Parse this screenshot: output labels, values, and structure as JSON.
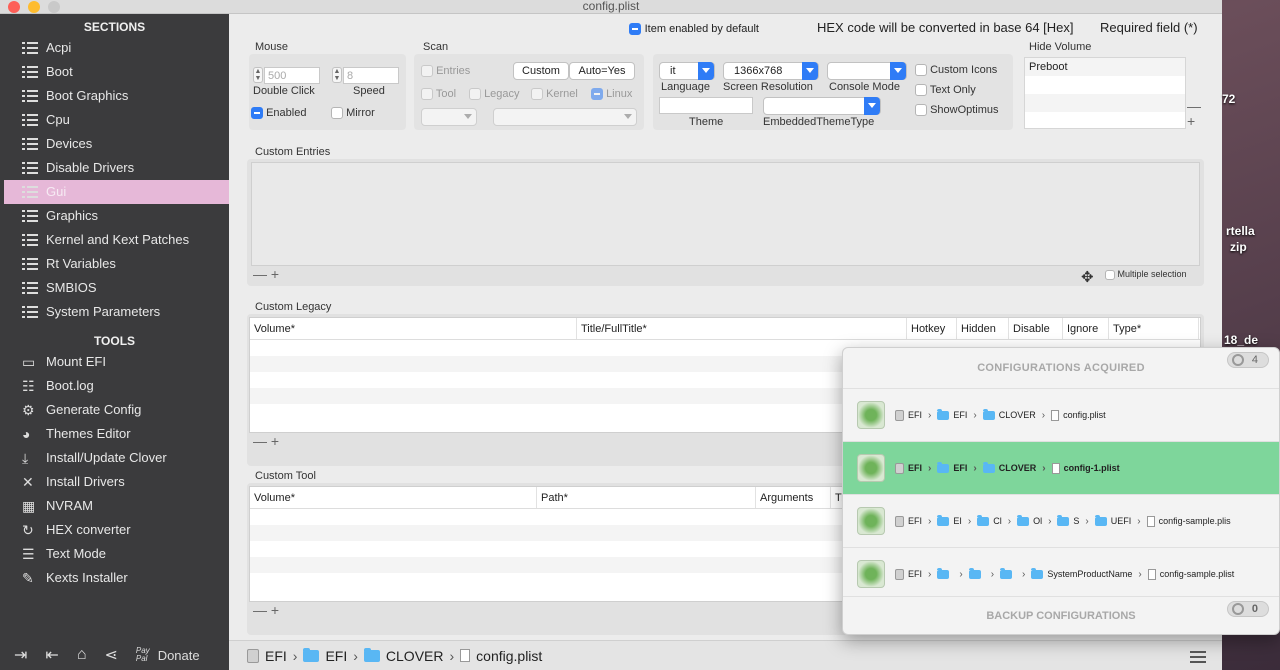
{
  "window": {
    "title": "config.plist"
  },
  "sidebar": {
    "sections_title": "SECTIONS",
    "sections": [
      {
        "label": "Acpi",
        "icon": "list-icon"
      },
      {
        "label": "Boot",
        "icon": "list-icon"
      },
      {
        "label": "Boot Graphics",
        "icon": "list-icon"
      },
      {
        "label": "Cpu",
        "icon": "list-icon"
      },
      {
        "label": "Devices",
        "icon": "list-icon"
      },
      {
        "label": "Disable Drivers",
        "icon": "list-icon"
      },
      {
        "label": "Gui",
        "icon": "list-icon",
        "selected": true
      },
      {
        "label": "Graphics",
        "icon": "list-icon"
      },
      {
        "label": "Kernel and Kext Patches",
        "icon": "list-icon"
      },
      {
        "label": "Rt Variables",
        "icon": "list-icon"
      },
      {
        "label": "SMBIOS",
        "icon": "list-icon"
      },
      {
        "label": "System Parameters",
        "icon": "list-icon"
      }
    ],
    "tools_title": "TOOLS",
    "tools": [
      {
        "label": "Mount EFI",
        "icon": "mount-icon",
        "glyph": "▭"
      },
      {
        "label": "Boot.log",
        "icon": "log-icon",
        "glyph": "☷"
      },
      {
        "label": "Generate Config",
        "icon": "gear-icon",
        "glyph": "⚙"
      },
      {
        "label": "Themes Editor",
        "icon": "palette-icon",
        "glyph": "◕"
      },
      {
        "label": "Install/Update Clover",
        "icon": "download-icon",
        "glyph": "⤓"
      },
      {
        "label": "Install Drivers",
        "icon": "wrench-icon",
        "glyph": "✕"
      },
      {
        "label": "NVRAM",
        "icon": "chip-icon",
        "glyph": "▦"
      },
      {
        "label": "HEX converter",
        "icon": "refresh-icon",
        "glyph": "↻"
      },
      {
        "label": "Text Mode",
        "icon": "text-icon",
        "glyph": "☰"
      },
      {
        "label": "Kexts Installer",
        "icon": "puzzle-icon",
        "glyph": "✎"
      }
    ],
    "footer": {
      "paypal_line1": "Pay",
      "paypal_line2": "Pal",
      "donate": "Donate"
    }
  },
  "header": {
    "item_enabled_default": "Item enabled by default",
    "hex_note": "HEX code will be converted in base 64 [Hex]",
    "required_note": "Required field (*)"
  },
  "mouse": {
    "title": "Mouse",
    "double_click_value": "500",
    "double_click_label": "Double Click",
    "speed_value": "8",
    "speed_label": "Speed",
    "enabled_label": "Enabled",
    "mirror_label": "Mirror"
  },
  "scan": {
    "title": "Scan",
    "entries": "Entries",
    "tool": "Tool",
    "legacy": "Legacy",
    "kernel": "Kernel",
    "linux": "Linux",
    "custom_btn": "Custom",
    "auto_btn": "Auto=Yes"
  },
  "gui": {
    "language_value": "it",
    "language_label": "Language",
    "resolution_value": "1366x768",
    "resolution_label": "Screen Resolution",
    "console_label": "Console Mode",
    "theme_label": "Theme",
    "embedded_label": "EmbeddedThemeType",
    "custom_icons": "Custom Icons",
    "text_only": "Text Only",
    "show_optimus": "ShowOptimus"
  },
  "hide_volume": {
    "title": "Hide Volume",
    "items": [
      "Preboot"
    ]
  },
  "custom_entries": {
    "title": "Custom Entries",
    "multiple_selection": "Multiple selection"
  },
  "custom_legacy": {
    "title": "Custom Legacy",
    "columns": [
      "Volume*",
      "Title/FullTitle*",
      "Hotkey",
      "Hidden",
      "Disable",
      "Ignore",
      "Type*"
    ]
  },
  "custom_tool": {
    "title": "Custom Tool",
    "columns": [
      "Volume*",
      "Path*",
      "Arguments",
      "Ti"
    ]
  },
  "pathbar": {
    "items": [
      "EFI",
      "EFI",
      "CLOVER",
      "config.plist"
    ]
  },
  "desktop": {
    "labels": [
      "72",
      "rtella",
      "zip",
      "18_de"
    ]
  },
  "popover": {
    "title": "CONFIGURATIONS ACQUIRED",
    "count": "4",
    "rows": [
      {
        "path": [
          "EFI",
          "EFI",
          "CLOVER"
        ],
        "file": "config.plist",
        "active": false
      },
      {
        "path": [
          "EFI",
          "EFI",
          "CLOVER"
        ],
        "file": "config-1.plist",
        "active": true
      },
      {
        "path": [
          "EFI",
          "EI",
          "Cl",
          "Ol",
          "S",
          "UEFI"
        ],
        "file": "config-sample.plis",
        "active": false
      },
      {
        "path": [
          "EFI",
          "",
          "",
          "",
          "SystemProductName"
        ],
        "file": "config-sample.plist",
        "active": false
      }
    ],
    "backup_title": "BACKUP CONFIGURATIONS",
    "backup_count": "0"
  }
}
